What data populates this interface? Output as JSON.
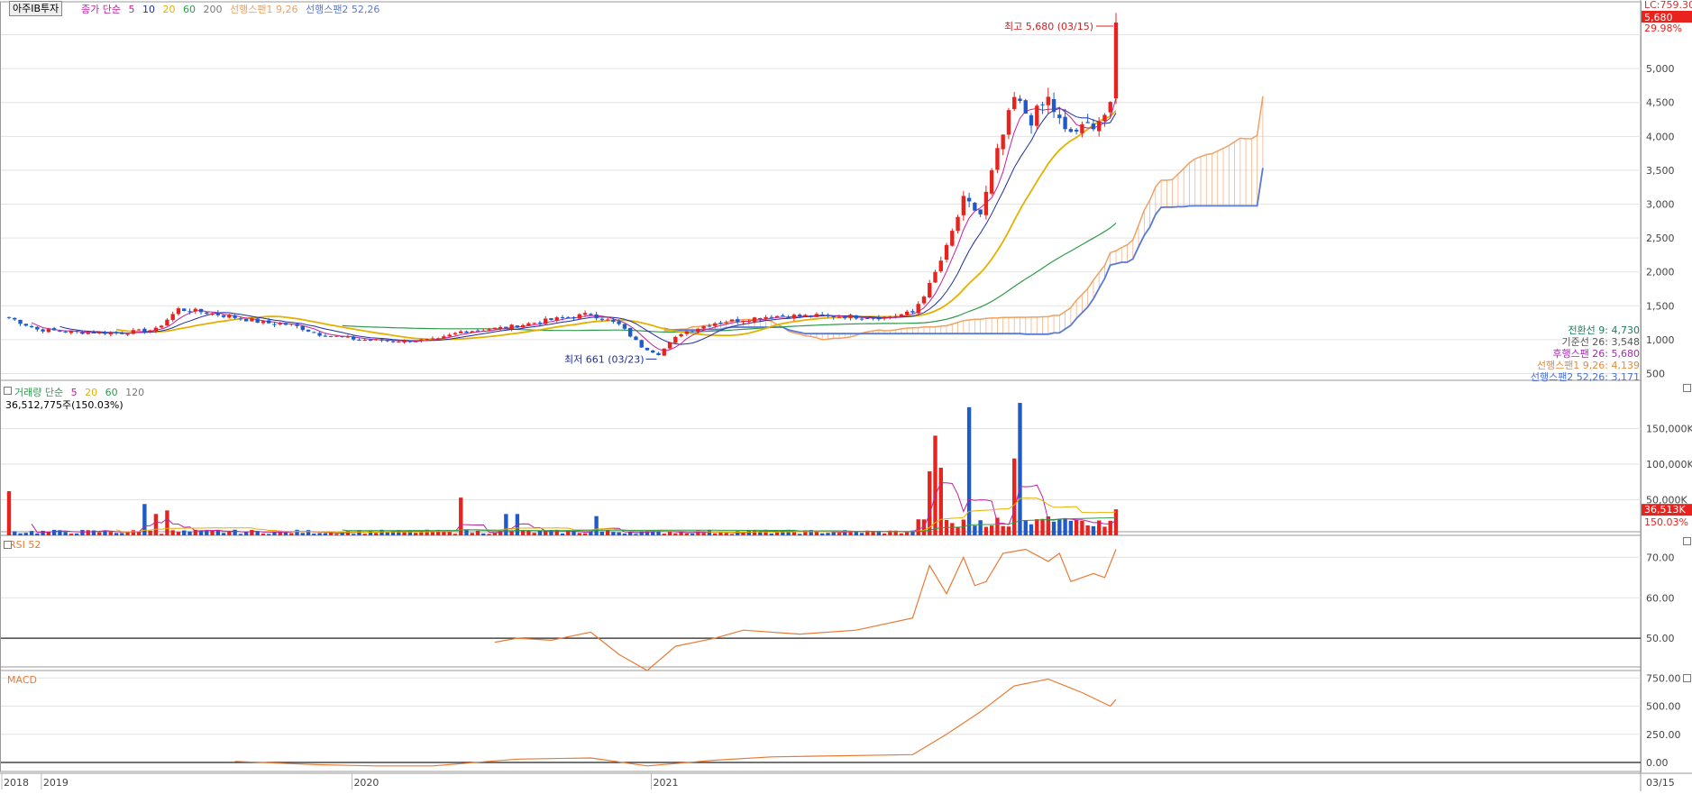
{
  "stock": {
    "name": "아주IB투자"
  },
  "price_legend": {
    "prefix": "종가 단순",
    "ma": [
      "5",
      "10",
      "20",
      "60",
      "200"
    ],
    "span1": "선행스팬1 9,26",
    "span2": "선행스팬2 52,26"
  },
  "price_axis": {
    "ticks": [
      "5,000",
      "4,500",
      "4,000",
      "3,500",
      "3,000",
      "2,500",
      "2,000",
      "1,500",
      "1,000",
      "500"
    ],
    "top_label": "LC:759.30",
    "current_price": "5,680",
    "change_pct": "29.98%"
  },
  "annotations": {
    "high": "최고 5,680 (03/15)",
    "low": "최저 661 (03/23)"
  },
  "ichimoku_values": [
    {
      "label": "전환선 9: 4,730",
      "color": "#1a7f5a"
    },
    {
      "label": "기준선 26: 3,548",
      "color": "#555555"
    },
    {
      "label": "후행스팬 26: 5,680",
      "color": "#9b2fa8"
    },
    {
      "label": "선행스팬1 9,26: 4,139",
      "color": "#e88a3a"
    },
    {
      "label": "선행스팬2 52,26: 3,171",
      "color": "#4a6fd8"
    }
  ],
  "volume_legend": {
    "prefix": "거래량 단순",
    "ma": [
      "5",
      "20",
      "60",
      "120"
    ],
    "current": "36,512,775주(150.03%)"
  },
  "volume_axis": {
    "ticks": [
      "150,000K",
      "100,000K",
      "50,000K"
    ],
    "current": "36,513K",
    "pct": "150.03%"
  },
  "rsi": {
    "label": "RSI 52",
    "ticks": [
      "70.00",
      "60.00",
      "50.00"
    ]
  },
  "macd": {
    "label": "MACD",
    "ticks": [
      "750.00",
      "500.00",
      "250.00",
      "0.00"
    ]
  },
  "x_axis": {
    "labels": [
      "2018",
      "2019",
      "2020",
      "2021"
    ],
    "end_label": "03/15"
  },
  "colors": {
    "up": "#e8231e",
    "down": "#1e5ac8",
    "ma5": "#c0219e",
    "ma10": "#1c2f9e",
    "ma20": "#e6b000",
    "ma60": "#2e9a4c",
    "span1": "#f0a060",
    "span2": "#5a78d8",
    "rsi": "#e87a34",
    "macd": "#e87a34"
  },
  "chart_data": {
    "type": "candlestick",
    "title": "아주IB투자",
    "price_ylim": [
      500,
      5800
    ],
    "price_keyframes": [
      {
        "i": 0,
        "p": 1330
      },
      {
        "i": 5,
        "p": 1150
      },
      {
        "i": 12,
        "p": 1110
      },
      {
        "i": 20,
        "p": 1100
      },
      {
        "i": 26,
        "p": 1150
      },
      {
        "i": 30,
        "p": 1450
      },
      {
        "i": 35,
        "p": 1400
      },
      {
        "i": 40,
        "p": 1330
      },
      {
        "i": 45,
        "p": 1250
      },
      {
        "i": 50,
        "p": 1220
      },
      {
        "i": 55,
        "p": 1080
      },
      {
        "i": 62,
        "p": 1000
      },
      {
        "i": 70,
        "p": 980
      },
      {
        "i": 76,
        "p": 1000
      },
      {
        "i": 80,
        "p": 1120
      },
      {
        "i": 88,
        "p": 1180
      },
      {
        "i": 95,
        "p": 1280
      },
      {
        "i": 103,
        "p": 1380
      },
      {
        "i": 108,
        "p": 1220
      },
      {
        "i": 112,
        "p": 900
      },
      {
        "i": 115,
        "p": 790
      },
      {
        "i": 119,
        "p": 1100
      },
      {
        "i": 125,
        "p": 1250
      },
      {
        "i": 135,
        "p": 1350
      },
      {
        "i": 145,
        "p": 1350
      },
      {
        "i": 155,
        "p": 1330
      },
      {
        "i": 160,
        "p": 1400
      },
      {
        "i": 163,
        "p": 1800
      },
      {
        "i": 166,
        "p": 2350
      },
      {
        "i": 169,
        "p": 3050
      },
      {
        "i": 172,
        "p": 2850
      },
      {
        "i": 175,
        "p": 3750
      },
      {
        "i": 178,
        "p": 4550
      },
      {
        "i": 181,
        "p": 4250
      },
      {
        "i": 184,
        "p": 4550
      },
      {
        "i": 187,
        "p": 4050
      },
      {
        "i": 190,
        "p": 4100
      },
      {
        "i": 193,
        "p": 4250
      },
      {
        "i": 195,
        "p": 4400
      },
      {
        "i": 196,
        "p": 5680
      }
    ],
    "volume_ylim": [
      0,
      200000
    ],
    "volume_spikes": [
      {
        "i": 0,
        "v": 62000
      },
      {
        "i": 24,
        "v": 44000
      },
      {
        "i": 26,
        "v": 30000
      },
      {
        "i": 28,
        "v": 35000
      },
      {
        "i": 80,
        "v": 53000
      },
      {
        "i": 88,
        "v": 30000
      },
      {
        "i": 90,
        "v": 30000
      },
      {
        "i": 104,
        "v": 27000
      },
      {
        "i": 163,
        "v": 90000
      },
      {
        "i": 164,
        "v": 140000
      },
      {
        "i": 165,
        "v": 95000
      },
      {
        "i": 170,
        "v": 180000
      },
      {
        "i": 178,
        "v": 108000
      },
      {
        "i": 179,
        "v": 186000
      },
      {
        "i": 196,
        "v": 36513
      }
    ],
    "rsi_ylim": [
      42,
      75
    ],
    "rsi_points": [
      {
        "i": 86,
        "v": 49
      },
      {
        "i": 90,
        "v": 50
      },
      {
        "i": 96,
        "v": 49.5
      },
      {
        "i": 103,
        "v": 51.5
      },
      {
        "i": 108,
        "v": 46
      },
      {
        "i": 113,
        "v": 42
      },
      {
        "i": 118,
        "v": 48
      },
      {
        "i": 125,
        "v": 50
      },
      {
        "i": 130,
        "v": 52
      },
      {
        "i": 140,
        "v": 51
      },
      {
        "i": 150,
        "v": 52
      },
      {
        "i": 160,
        "v": 55
      },
      {
        "i": 163,
        "v": 68
      },
      {
        "i": 166,
        "v": 61
      },
      {
        "i": 169,
        "v": 70
      },
      {
        "i": 171,
        "v": 63
      },
      {
        "i": 173,
        "v": 64
      },
      {
        "i": 176,
        "v": 71
      },
      {
        "i": 180,
        "v": 72
      },
      {
        "i": 184,
        "v": 69
      },
      {
        "i": 186,
        "v": 71
      },
      {
        "i": 188,
        "v": 64
      },
      {
        "i": 192,
        "v": 66
      },
      {
        "i": 194,
        "v": 65
      },
      {
        "i": 196,
        "v": 72
      }
    ],
    "macd_ylim": [
      -80,
      800
    ],
    "macd_points": [
      {
        "i": 40,
        "v": 10
      },
      {
        "i": 55,
        "v": -20
      },
      {
        "i": 65,
        "v": -30
      },
      {
        "i": 75,
        "v": -30
      },
      {
        "i": 90,
        "v": 30
      },
      {
        "i": 103,
        "v": 40
      },
      {
        "i": 113,
        "v": -30
      },
      {
        "i": 125,
        "v": 20
      },
      {
        "i": 135,
        "v": 50
      },
      {
        "i": 160,
        "v": 70
      },
      {
        "i": 166,
        "v": 250
      },
      {
        "i": 172,
        "v": 450
      },
      {
        "i": 178,
        "v": 680
      },
      {
        "i": 184,
        "v": 740
      },
      {
        "i": 190,
        "v": 620
      },
      {
        "i": 195,
        "v": 500
      },
      {
        "i": 196,
        "v": 560
      }
    ],
    "x_ticks": [
      {
        "label": "2018",
        "i": 0
      },
      {
        "label": "2019",
        "i": 7
      },
      {
        "label": "2020",
        "i": 62
      },
      {
        "label": "2021",
        "i": 115
      }
    ]
  }
}
